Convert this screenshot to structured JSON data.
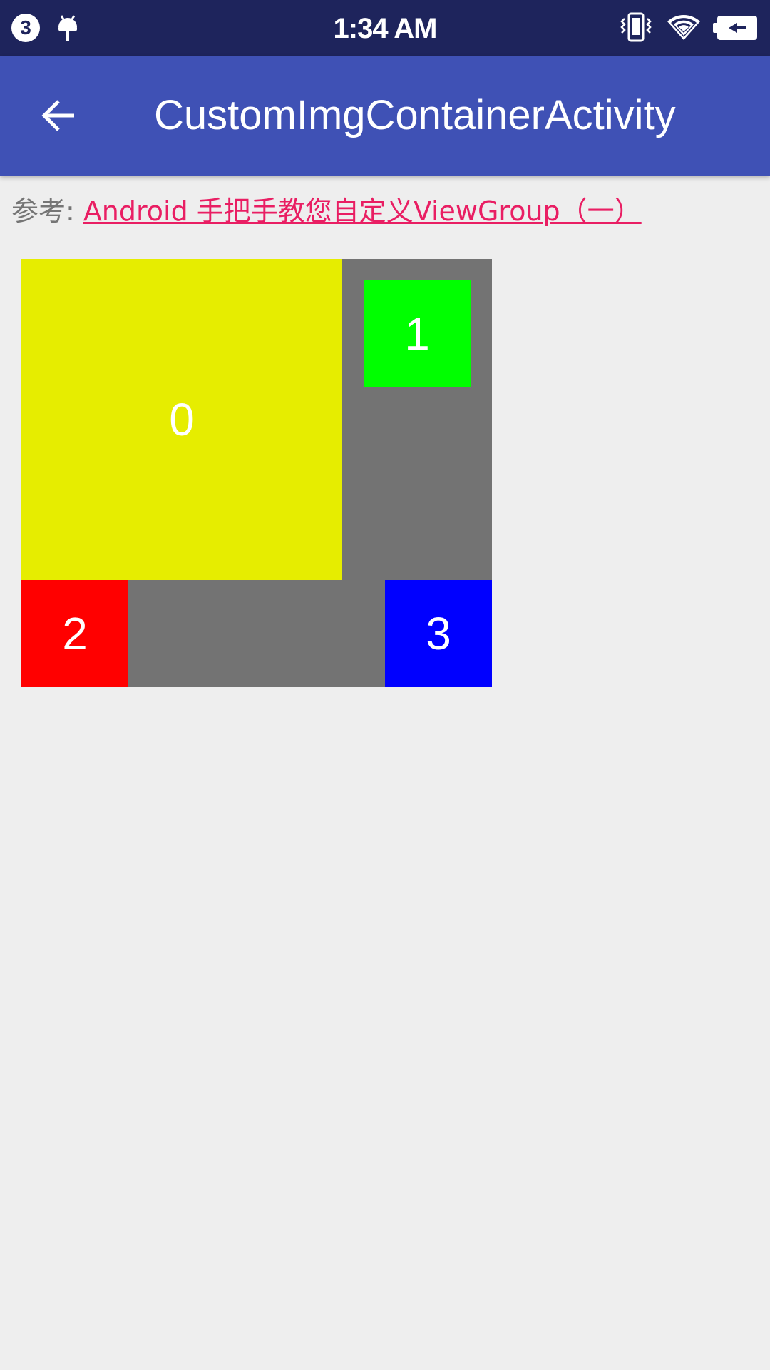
{
  "status_bar": {
    "notification_count": "3",
    "time": "1:34 AM",
    "icons": [
      "notification-count-icon",
      "android-debug-icon",
      "vibrate-icon",
      "wifi-icon",
      "battery-charging-icon"
    ],
    "background_color": "#1e245c"
  },
  "app_bar": {
    "back_icon": "arrow-back-icon",
    "title": "CustomImgContainerActivity",
    "background_color": "#3f51b5"
  },
  "reference": {
    "label": "参考:",
    "link_text": "Android 手把手教您自定义ViewGroup（一）",
    "link_color": "#e91e63"
  },
  "container": {
    "background_color": "#737373",
    "tiles": [
      {
        "label": "0",
        "color": "#e6ed00"
      },
      {
        "label": "1",
        "color": "#00ff00"
      },
      {
        "label": "2",
        "color": "#ff0000"
      },
      {
        "label": "3",
        "color": "#0000ff"
      }
    ]
  }
}
